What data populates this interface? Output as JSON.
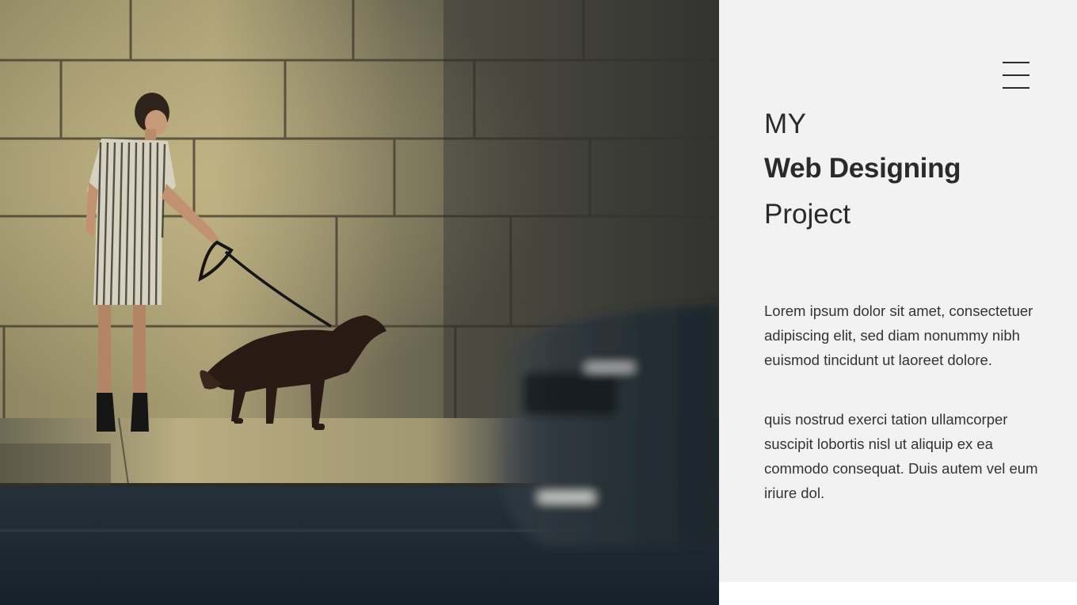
{
  "hero": {
    "image_label": "person-walking-dog-by-stone-wall-photo"
  },
  "panel": {
    "menu_icon": "hamburger-menu-icon",
    "title": {
      "line1": "MY",
      "line2": "Web Designing",
      "line3": "Project"
    },
    "paragraph1": "Lorem ipsum dolor sit amet, consectetuer adipiscing elit, sed diam nonummy nibh euismod tincidunt ut laoreet dolore.",
    "paragraph2": "quis nostrud exerci tation ullamcorper suscipit lobortis nisl ut aliquip ex ea commodo consequat. Duis autem vel eum iriure dol."
  },
  "colors": {
    "panel_background": "#f2f2f2",
    "text_dark": "#2a2a2a",
    "photo_shadow": "#1d2a33",
    "wall_light": "#b3a77f"
  }
}
